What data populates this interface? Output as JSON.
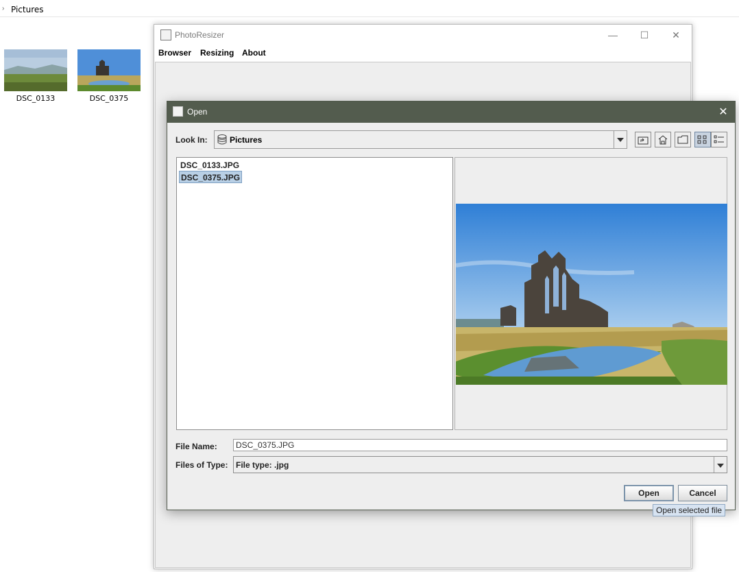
{
  "explorer": {
    "breadcrumb": "Pictures",
    "thumbnails": [
      {
        "label": "DSC_0133"
      },
      {
        "label": "DSC_0375"
      }
    ]
  },
  "main_window": {
    "title": "PhotoResizer",
    "menu": [
      "Browser",
      "Resizing",
      "About"
    ]
  },
  "dialog": {
    "title": "Open",
    "look_in_label": "Look In:",
    "look_in_value": "Pictures",
    "toolbar_icons": [
      "up-one-level-icon",
      "home-icon",
      "new-folder-icon",
      "list-view-icon",
      "details-view-icon"
    ],
    "files": [
      "DSC_0133.JPG",
      "DSC_0375.JPG"
    ],
    "selected_file": "DSC_0375.JPG",
    "file_name_label": "File Name:",
    "file_name_value": "DSC_0375.JPG",
    "files_of_type_label": "Files of Type:",
    "files_of_type_value": "File type: .jpg",
    "open_label": "Open",
    "cancel_label": "Cancel",
    "tooltip": "Open selected file"
  },
  "colors": {
    "dialog_title_bar": "#535c4e",
    "selection": "#b8cfe5",
    "tooltip_bg": "#d7e3f1"
  }
}
